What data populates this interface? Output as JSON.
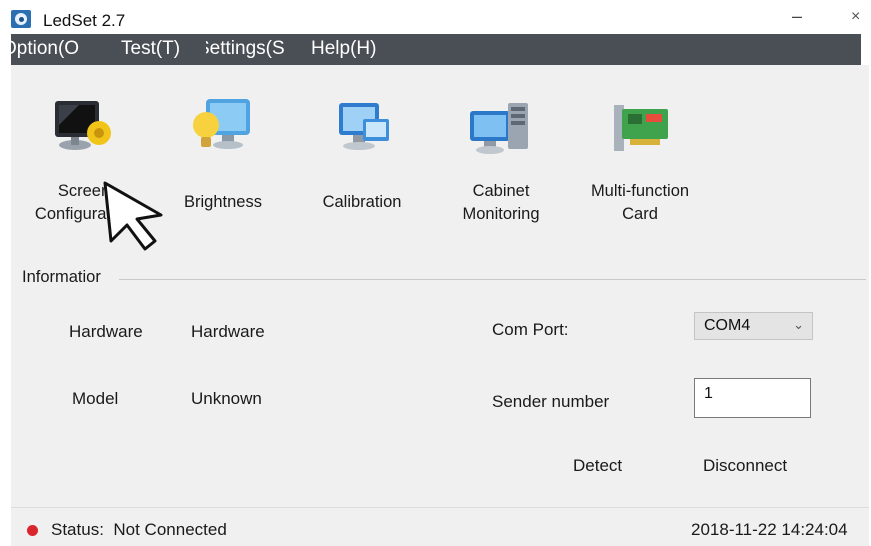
{
  "window": {
    "title": "LedSet 2.7",
    "minimize_glyph": "–",
    "close_glyph": "×",
    "app_icon": "eye-icon"
  },
  "menu": {
    "items": [
      {
        "label": "Option(O"
      },
      {
        "label": "Test(T)"
      },
      {
        "label": "Settings(S"
      },
      {
        "label": "Help(H)"
      }
    ]
  },
  "toolbar": {
    "items": [
      {
        "label_lines": [
          "Screen",
          "Configuration"
        ],
        "icon": "screen-configuration-icon"
      },
      {
        "label_lines": [
          "Brightness"
        ],
        "icon": "brightness-icon"
      },
      {
        "label_lines": [
          "Calibration"
        ],
        "icon": "calibration-icon"
      },
      {
        "label_lines": [
          "Cabinet",
          "Monitoring"
        ],
        "icon": "cabinet-monitoring-icon"
      },
      {
        "label_lines": [
          "Multi-function",
          "Card"
        ],
        "icon": "multi-function-card-icon"
      }
    ]
  },
  "info": {
    "title": "Informatior",
    "hardware_label": "Hardware",
    "hardware_value": "Hardware",
    "model_label": "Model",
    "model_value": "Unknown",
    "com_port_label": "Com Port:",
    "com_port_value": "COM4",
    "sender_number_label": "Sender number",
    "sender_number_value": "1",
    "detect_label": "Detect",
    "disconnect_label": "Disconnect"
  },
  "status": {
    "label": "Status:",
    "value": "Not Connected",
    "timestamp": "2018-11-22 14:24:04",
    "indicator_color": "#d9262c"
  },
  "colors": {
    "menubar_bg": "#4a4e55",
    "client_bg": "#f0f0f0"
  }
}
